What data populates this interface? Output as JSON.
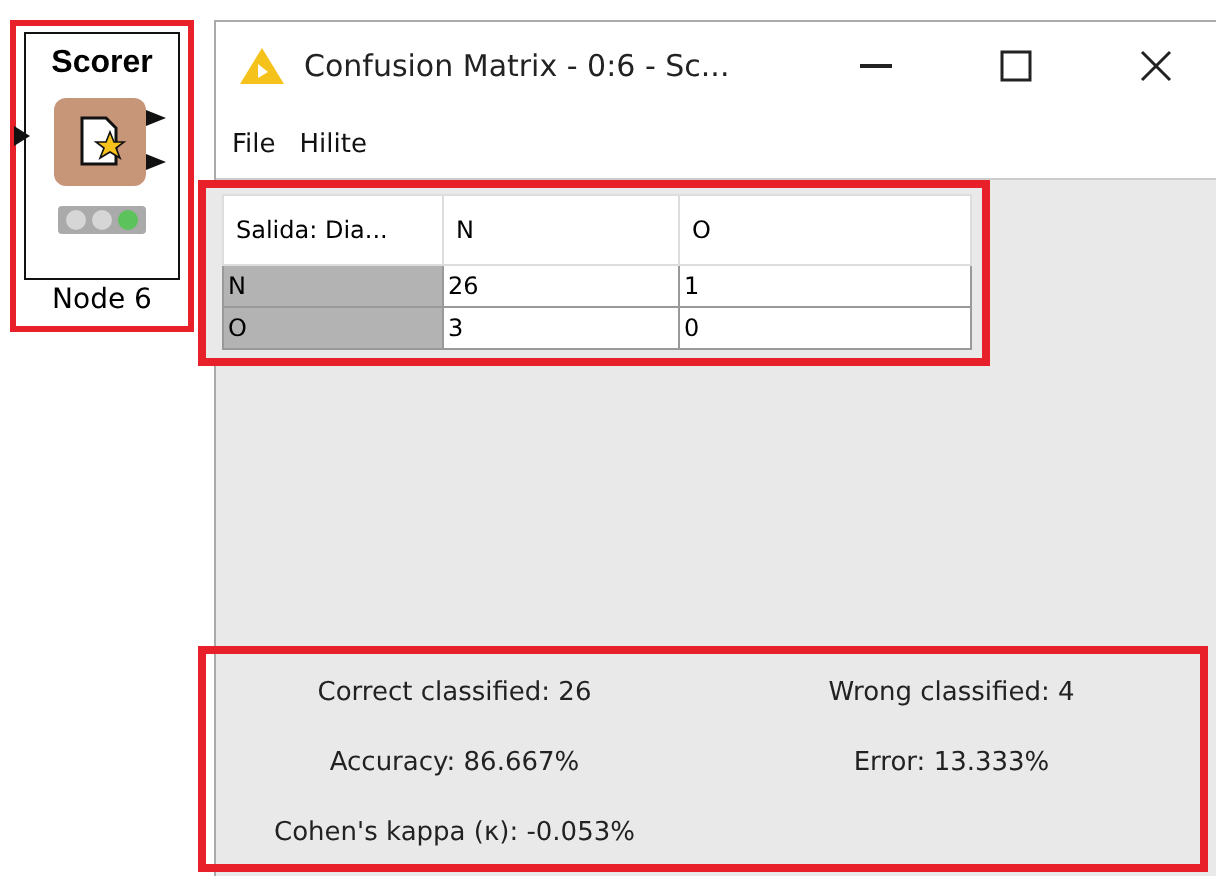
{
  "node": {
    "title": "Scorer",
    "label": "Node 6",
    "lights": [
      {
        "color": "#d6d6d6"
      },
      {
        "color": "#d6d6d6"
      },
      {
        "color": "#5cc25c"
      }
    ]
  },
  "window": {
    "title": "Confusion Matrix - 0:6 - Sc..."
  },
  "menu": [
    "File",
    "Hilite"
  ],
  "table": {
    "columns": [
      "Salida: Dia...",
      "N",
      "O"
    ],
    "rows": [
      [
        "N",
        "26",
        "1"
      ],
      [
        "O",
        "3",
        "0"
      ]
    ]
  },
  "stats": [
    "Correct classified:  26",
    "Wrong classified:  4",
    "Accuracy:  86.667%",
    "Error:  13.333%",
    "Cohen's kappa (κ):   -0.053%"
  ]
}
